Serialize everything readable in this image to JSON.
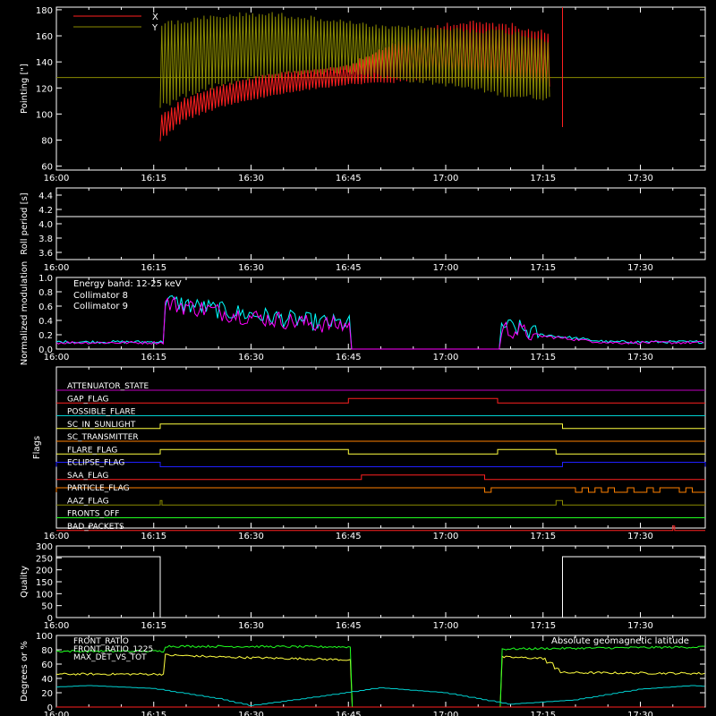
{
  "chart_data": [
    {
      "type": "line",
      "ylabel": "Pointing [\"]",
      "ylim": [
        57,
        182
      ],
      "yticks": [
        60,
        80,
        100,
        120,
        140,
        160,
        180
      ],
      "xlim": [
        "16:00",
        "17:40"
      ],
      "xticks": [
        "16:00",
        "16:15",
        "16:30",
        "16:45",
        "17:00",
        "17:15",
        "17:30"
      ],
      "legend": {
        "placement": "top-left",
        "entries": [
          {
            "name": "X",
            "color": "#ff2020"
          },
          {
            "name": "Y",
            "color": "#8a8a00"
          }
        ]
      },
      "series": [
        {
          "name": "X",
          "color": "#ff2020",
          "x": [
            "16:16",
            "16:20",
            "16:25",
            "16:30",
            "16:35",
            "16:40",
            "16:45",
            "16:50",
            "16:55",
            "17:00",
            "17:05",
            "17:10",
            "17:16"
          ],
          "min": [
            78,
            95,
            104,
            110,
            115,
            119,
            122,
            123,
            124,
            124,
            122,
            120,
            120
          ],
          "max": [
            100,
            113,
            122,
            128,
            133,
            135,
            138,
            150,
            163,
            171,
            172,
            170,
            164
          ]
        },
        {
          "name": "Y",
          "color": "#8a8a00",
          "x": [
            "16:16",
            "16:20",
            "16:25",
            "16:30",
            "16:35",
            "16:40",
            "16:45",
            "16:50",
            "16:55",
            "17:00",
            "17:05",
            "17:10",
            "17:16"
          ],
          "min": [
            100,
            112,
            120,
            125,
            128,
            130,
            131,
            128,
            124,
            121,
            117,
            112,
            110
          ],
          "max": [
            172,
            174,
            177,
            179,
            178,
            175,
            172,
            168,
            168,
            167,
            166,
            165,
            158
          ]
        }
      ],
      "baseline": {
        "y": 128
      }
    },
    {
      "type": "line",
      "ylabel": "Roll period [s]",
      "ylim": [
        3.5,
        4.5
      ],
      "yticks": [
        "3.6",
        "3.8",
        "4.0",
        "4.2",
        "4.4"
      ],
      "xticks": [
        "16:00",
        "16:15",
        "16:30",
        "16:45",
        "17:00",
        "17:15",
        "17:30"
      ],
      "series": [
        {
          "name": "roll",
          "x": [
            "16:00",
            "17:40"
          ],
          "y": [
            4.1,
            4.1
          ]
        }
      ]
    },
    {
      "type": "line",
      "ylabel": "Normalized modulation",
      "ylim": [
        0,
        1
      ],
      "yticks": [
        "0.0",
        "0.2",
        "0.4",
        "0.6",
        "0.8",
        "1.0"
      ],
      "xticks": [
        "16:00",
        "16:15",
        "16:30",
        "16:45",
        "17:00",
        "17:15",
        "17:30"
      ],
      "annotation": "Energy band: 12-25 keV",
      "legend": {
        "placement": "top-left",
        "entries": [
          {
            "name": "Collimator 8",
            "color": "#00ffff"
          },
          {
            "name": "Collimator 9",
            "color": "#ff00ff"
          }
        ]
      },
      "series": [
        {
          "name": "Collimator 8",
          "x": [
            "16:00",
            "16:16",
            "16:16",
            "16:20",
            "16:30",
            "16:40",
            "16:45",
            "16:45",
            "17:08",
            "17:08",
            "17:15",
            "17:25",
            "17:40"
          ],
          "y": [
            0.1,
            0.1,
            0.7,
            0.62,
            0.48,
            0.38,
            0.35,
            0.0,
            0.0,
            0.35,
            0.2,
            0.1,
            0.1
          ]
        },
        {
          "name": "Collimator 9",
          "x": [
            "16:00",
            "16:16",
            "16:16",
            "16:20",
            "16:30",
            "16:40",
            "16:45",
            "16:45",
            "17:08",
            "17:08",
            "17:15",
            "17:25",
            "17:40"
          ],
          "y": [
            0.09,
            0.09,
            0.65,
            0.6,
            0.45,
            0.35,
            0.33,
            0.0,
            0.0,
            0.3,
            0.18,
            0.09,
            0.09
          ]
        }
      ]
    },
    {
      "type": "line",
      "ylabel": "Flags",
      "xticks": [
        "16:00",
        "16:15",
        "16:30",
        "16:45",
        "17:00",
        "17:15",
        "17:30"
      ],
      "flags": [
        {
          "name": "ATTENUATOR_STATE",
          "color": "#c000c0",
          "high": []
        },
        {
          "name": "GAP_FLAG",
          "color": "#ff2020",
          "high": [
            [
              "16:45",
              "17:08"
            ]
          ]
        },
        {
          "name": "POSSIBLE_FLARE",
          "color": "#00d0d0",
          "high": []
        },
        {
          "name": "SC_IN_SUNLIGHT",
          "color": "#ffff40",
          "high": [
            [
              "16:16",
              "17:18"
            ]
          ]
        },
        {
          "name": "SC_TRANSMITTER",
          "color": "#ff8000",
          "high": []
        },
        {
          "name": "FLARE_FLAG",
          "color": "#ffff40",
          "high": [
            [
              "16:16",
              "16:45"
            ],
            [
              "17:08",
              "17:17"
            ]
          ]
        },
        {
          "name": "ECLIPSE_FLAG",
          "color": "#2020ff",
          "high": [
            [
              "16:00",
              "16:16"
            ],
            [
              "17:18",
              "17:40"
            ]
          ]
        },
        {
          "name": "SAA_FLAG",
          "color": "#ff2020",
          "high": [
            [
              "16:47",
              "17:06"
            ]
          ]
        },
        {
          "name": "PARTICLE_FLAG",
          "color": "#ff8000",
          "high": [
            [
              "16:00",
              "17:06"
            ],
            [
              "17:07",
              "17:20"
            ],
            [
              "17:21",
              "17:22"
            ],
            [
              "17:23",
              "17:24"
            ],
            [
              "17:25",
              "17:26"
            ],
            [
              "17:28",
              "17:29"
            ],
            [
              "17:31",
              "17:32"
            ],
            [
              "17:33",
              "17:36"
            ],
            [
              "17:37",
              "17:38"
            ]
          ]
        },
        {
          "name": "AAZ_FLAG",
          "color": "#8a8a00",
          "high": [
            [
              "16:16",
              "16:16"
            ],
            [
              "17:17",
              "17:18"
            ]
          ]
        },
        {
          "name": "FRONTS_OFF",
          "color": "#20ff20",
          "high": []
        },
        {
          "name": "BAD_PACKETS",
          "color": "#ff2020",
          "high": [
            [
              "17:35",
              "17:35"
            ]
          ]
        }
      ]
    },
    {
      "type": "line",
      "ylabel": "Quality",
      "ylim": [
        0,
        300
      ],
      "yticks": [
        "0",
        "50",
        "100",
        "150",
        "200",
        "250",
        "300"
      ],
      "xticks": [
        "16:00",
        "16:15",
        "16:30",
        "16:45",
        "17:00",
        "17:15",
        "17:30"
      ],
      "series": [
        {
          "name": "quality",
          "x": [
            "16:00",
            "16:16",
            "16:16",
            "17:18",
            "17:18",
            "17:40"
          ],
          "y": [
            255,
            255,
            0,
            0,
            255,
            255
          ]
        }
      ]
    },
    {
      "type": "line",
      "ylabel": "Degrees or %",
      "ylim": [
        0,
        100
      ],
      "yticks": [
        "0",
        "20",
        "40",
        "60",
        "80",
        "100"
      ],
      "xticks": [
        "16:00",
        "16:15",
        "16:30",
        "16:45",
        "17:00",
        "17:15",
        "17:30"
      ],
      "legend": {
        "placement": "top-left",
        "entries": [
          {
            "name": "FRONT_RATIO",
            "color": "#ffff40"
          },
          {
            "name": "FRONT_RATIO_1225",
            "color": "#20ff20"
          },
          {
            "name": "MAX_DET_VS_TOT",
            "color": "#ff2020"
          }
        ]
      },
      "legend_right": {
        "name": "Absolute geomagnetic latitude",
        "color": "#00d0d0"
      },
      "series": [
        {
          "name": "FRONT_RATIO",
          "color": "#ffff40",
          "x": [
            "16:00",
            "16:16",
            "16:16",
            "16:25",
            "16:35",
            "16:45",
            "16:45",
            "17:08",
            "17:08",
            "17:15",
            "17:18",
            "17:40"
          ],
          "y": [
            46,
            46,
            73,
            70,
            68,
            66,
            0,
            0,
            70,
            68,
            48,
            47
          ]
        },
        {
          "name": "FRONT_RATIO_1225",
          "color": "#20ff20",
          "x": [
            "16:00",
            "16:16",
            "16:16",
            "16:45",
            "16:45",
            "17:08",
            "17:08",
            "17:40"
          ],
          "y": [
            78,
            78,
            85,
            84,
            0,
            0,
            81,
            84
          ]
        },
        {
          "name": "MAX_DET_VS_TOT",
          "color": "#ff2020",
          "x": [
            "16:00",
            "17:40"
          ],
          "y": [
            0,
            0
          ]
        },
        {
          "name": "Absolute geomagnetic latitude",
          "color": "#00d0d0",
          "x": [
            "16:00",
            "16:05",
            "16:15",
            "16:25",
            "16:30",
            "16:40",
            "16:50",
            "17:00",
            "17:10",
            "17:20",
            "17:30",
            "17:38",
            "17:40"
          ],
          "y": [
            28,
            30,
            26,
            12,
            2,
            14,
            27,
            20,
            4,
            10,
            25,
            30,
            29
          ]
        }
      ]
    }
  ]
}
